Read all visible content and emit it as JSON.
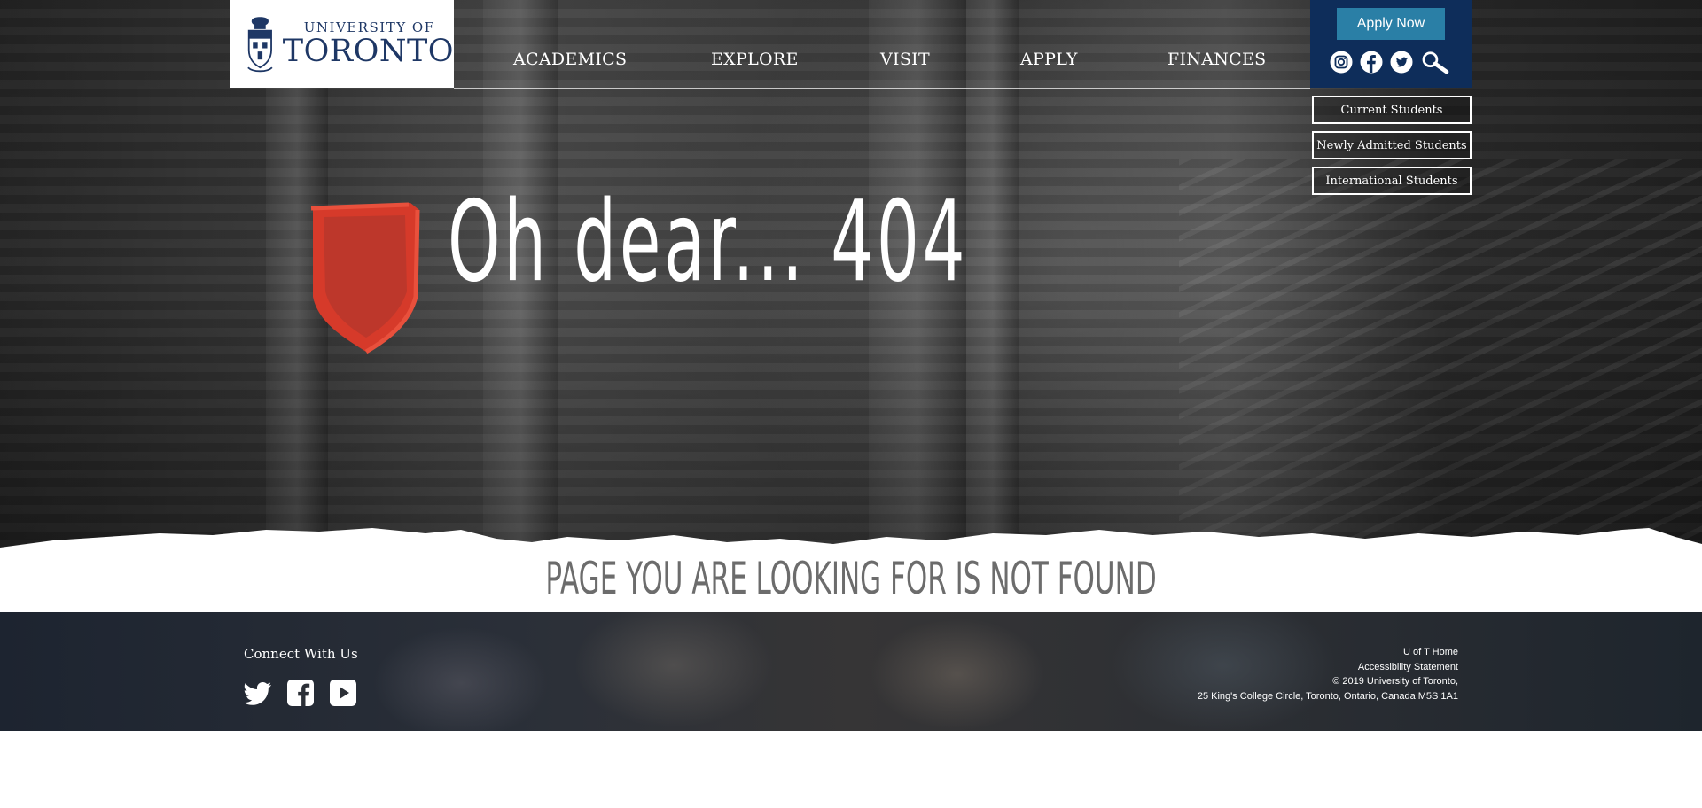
{
  "header": {
    "logo": {
      "line1": "UNIVERSITY OF",
      "line2": "TORONTO"
    },
    "nav": [
      {
        "label": "ACADEMICS"
      },
      {
        "label": "EXPLORE"
      },
      {
        "label": "VISIT"
      },
      {
        "label": "APPLY"
      },
      {
        "label": "FINANCES"
      }
    ],
    "apply_now": "Apply Now",
    "social_icons": [
      "instagram-icon",
      "facebook-icon",
      "twitter-icon",
      "search-icon"
    ],
    "quick_links": [
      "Current Students",
      "Newly Admitted Students",
      "International Students"
    ]
  },
  "hero": {
    "headline": "Oh dear... 404"
  },
  "not_found": "Page you are looking for is not found",
  "footer": {
    "connect_label": "Connect With Us",
    "social_icons": [
      "twitter-icon",
      "facebook-icon",
      "youtube-icon"
    ],
    "links": {
      "home": "U of T Home",
      "accessibility": "Accessibility Statement",
      "copyright": "© 2019 University of Toronto,",
      "address": "25 King's College Circle, Toronto, Ontario, Canada M5S 1A1"
    }
  },
  "colors": {
    "brand_navy": "#1e3765",
    "panel_navy": "#0e2d5a",
    "apply_button": "#2a7fa6",
    "shield_red": "#d63a2a",
    "not_found_text": "#6c6c6c"
  }
}
